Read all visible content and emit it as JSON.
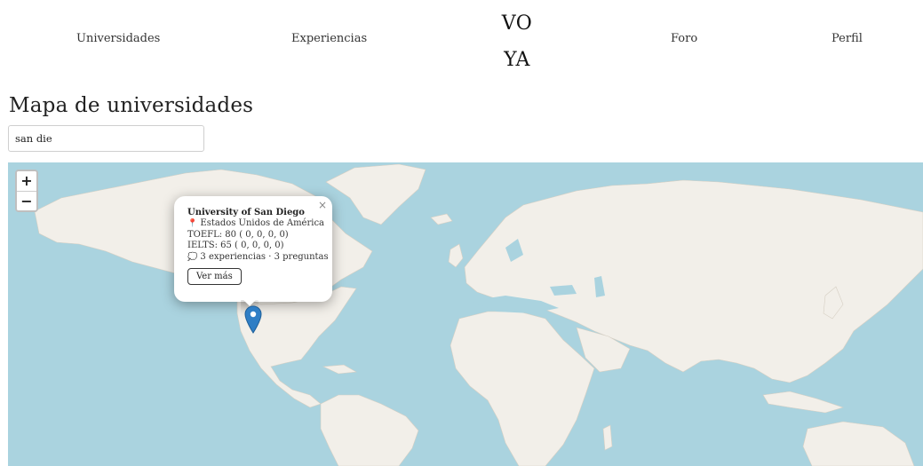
{
  "nav": {
    "items": [
      {
        "label": "Universidades"
      },
      {
        "label": "Experiencias"
      },
      {
        "label": "Foro"
      },
      {
        "label": "Perfil"
      }
    ],
    "logo_line1": "VO",
    "logo_line2": "YA"
  },
  "page": {
    "title": "Mapa de universidades"
  },
  "search": {
    "value": "san die"
  },
  "map": {
    "zoom_in_label": "+",
    "zoom_out_label": "−",
    "water_color": "#aad3df",
    "land_color": "#f2efe9",
    "marker_color": "#2f7ec5",
    "popup": {
      "close_label": "×",
      "university": "University of San Diego",
      "country": "Estados Unidos de América",
      "toefl": "TOEFL: 80 ( 0, 0, 0, 0)",
      "ielts": "IELTS: 65 ( 0, 0, 0, 0)",
      "stats": "3 experiencias · 3 preguntas",
      "button_label": "Ver más",
      "pin_icon": "📍",
      "bubble_icon": "💭"
    }
  }
}
